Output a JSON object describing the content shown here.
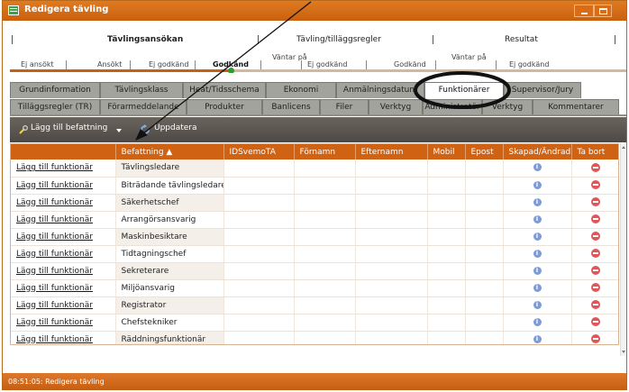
{
  "window": {
    "title": "Redigera tävling"
  },
  "workflow": {
    "stages": [
      "Tävlingsansökan",
      "Tävling/tilläggsregler",
      "Resultat"
    ],
    "statuses": [
      {
        "label": "Ej ansökt",
        "bold": false
      },
      {
        "label": "Ansökt",
        "bold": false
      },
      {
        "label": "Ej godkänd",
        "bold": false
      },
      {
        "label": "Godkänd",
        "bold": true
      },
      {
        "label": "Väntar på",
        "bold": false
      },
      {
        "label": "Ej godkänd",
        "bold": false
      },
      {
        "label": "Godkänd",
        "bold": false
      },
      {
        "label": "Väntar på",
        "bold": false
      },
      {
        "label": "Ej godkänd",
        "bold": false
      }
    ],
    "progress_fraction": 0.36
  },
  "tabs": {
    "row1": [
      "Grundinformation",
      "Tävlingsklass",
      "Heat/Tidsschema",
      "Ekonomi",
      "Anmälningsdatum",
      "Funktionärer",
      "Supervisor/Jury"
    ],
    "row2": [
      "Tilläggsregler (TR)",
      "Förarmeddelande",
      "Produkter",
      "Banlicens",
      "Filer",
      "Verktyg",
      "Administratör",
      "Verktyg",
      "Kommentarer"
    ],
    "active": "Funktionärer"
  },
  "toolbar": {
    "add_label": "Lägg till befattning",
    "update_label": "Uppdatera"
  },
  "grid": {
    "columns": [
      "",
      "Befattning ▲",
      "IDSvemoTA",
      "Förnamn",
      "Efternamn",
      "Mobil",
      "Epost",
      "Skapad/Ändrad",
      "Ta bort"
    ],
    "add_link": "Lägg till funktionär",
    "rows": [
      "Tävlingsledare",
      "Biträdande tävlingsledare",
      "Säkerhetschef",
      "Arrangörsansvarig",
      "Maskinbesiktare",
      "Tidtagningschef",
      "Sekreterare",
      "Miljöansvarig",
      "Registrator",
      "Chefstekniker",
      "Räddningsfunktionär"
    ]
  },
  "statusbar": {
    "text": "08:51:05: Redigera tävling"
  },
  "colors": {
    "accent": "#d06214",
    "tab_bg": "#a3a39d",
    "toolbar": "#5a554f"
  },
  "icons": [
    "window-app-icon",
    "minimize-icon",
    "maximize-icon",
    "wrench-icon",
    "refresh-icon",
    "info-icon",
    "delete-icon"
  ]
}
